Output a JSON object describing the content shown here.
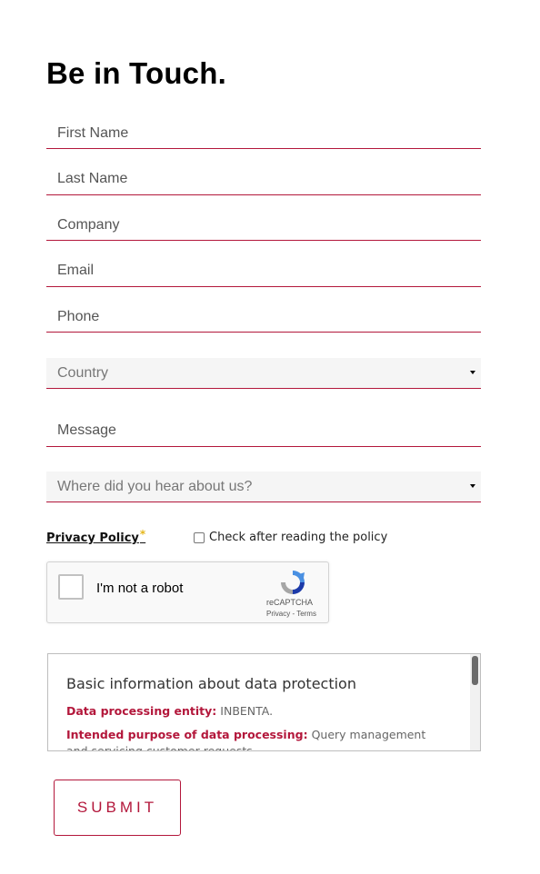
{
  "form": {
    "title": "Be in Touch.",
    "fields": {
      "first_name": "First Name",
      "last_name": "Last Name",
      "company": "Company",
      "email": "Email",
      "phone": "Phone",
      "message": "Message"
    },
    "country_select": "Country",
    "source_select": "Where did you hear about us?",
    "privacy_link": "Privacy Policy",
    "required_mark": "*",
    "policy_check_label": "Check after reading the policy",
    "submit_label": "SUBMIT"
  },
  "recaptcha": {
    "label": "I'm not a robot",
    "brand": "reCAPTCHA",
    "links": "Privacy - Terms"
  },
  "data_protection": {
    "heading": "Basic information about data protection",
    "entity_label": "Data processing entity:",
    "entity_value": "INBENTA.",
    "purpose_label": "Intended purpose of data processing:",
    "purpose_value": "Query management and servicing customer requests."
  },
  "colors": {
    "accent": "#b3173b",
    "required_star": "#e5b61b"
  }
}
